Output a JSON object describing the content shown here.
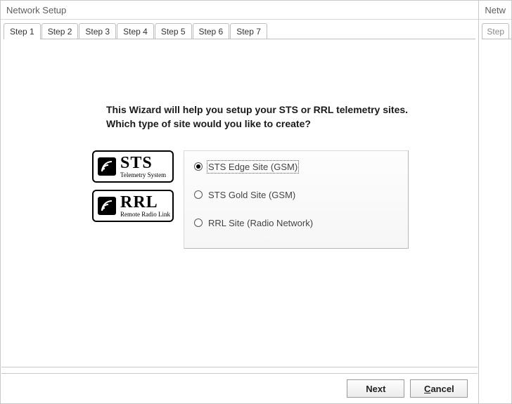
{
  "window": {
    "title": "Network Setup"
  },
  "side_window": {
    "title_fragment": "Netw",
    "tab_fragment": "Step"
  },
  "tabs": {
    "items": [
      {
        "label": "Step 1",
        "active": true
      },
      {
        "label": "Step 2",
        "active": false
      },
      {
        "label": "Step 3",
        "active": false
      },
      {
        "label": "Step 4",
        "active": false
      },
      {
        "label": "Step 5",
        "active": false
      },
      {
        "label": "Step 6",
        "active": false
      },
      {
        "label": "Step 7",
        "active": false
      }
    ]
  },
  "wizard": {
    "line1": "This Wizard will help you setup your STS or RRL telemetry sites.",
    "line2": "Which type of site would you like to create?"
  },
  "logos": {
    "sts": {
      "name": "STS",
      "subtitle": "Telemetry System"
    },
    "rrl": {
      "name": "RRL",
      "subtitle": "Remote Radio Link"
    }
  },
  "options": [
    {
      "id": "sts_edge",
      "label": "STS Edge Site (GSM)",
      "selected": true
    },
    {
      "id": "sts_gold",
      "label": "STS Gold Site (GSM)",
      "selected": false
    },
    {
      "id": "rrl",
      "label": "RRL Site (Radio Network)",
      "selected": false
    }
  ],
  "footer": {
    "next": "Next",
    "cancel_prefix": "C",
    "cancel_rest": "ancel"
  }
}
